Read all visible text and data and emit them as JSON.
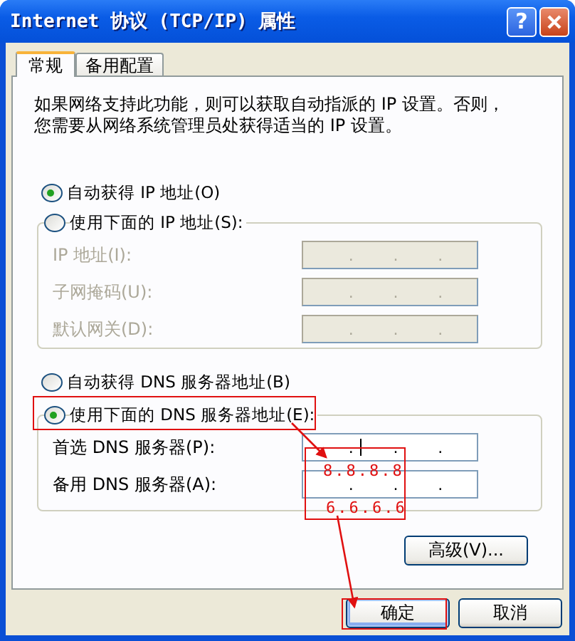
{
  "window": {
    "title": "Internet 协议 (TCP/IP) 属性",
    "help_button": "?"
  },
  "tabs": [
    {
      "label": "常规",
      "selected": true
    },
    {
      "label": "备用配置",
      "selected": false
    }
  ],
  "description": "如果网络支持此功能，则可以获取自动指派的 IP 设置。否则，您需要从网络系统管理员处获得适当的 IP 设置。",
  "ip_mode": [
    {
      "label": "自动获得 IP 地址(O)",
      "selected": true
    },
    {
      "label": "使用下面的 IP 地址(S):",
      "selected": false
    }
  ],
  "ip_fields": [
    {
      "label": "IP 地址(I):",
      "disabled": true,
      "separators": [
        ".",
        ".",
        "."
      ]
    },
    {
      "label": "子网掩码(U):",
      "disabled": true,
      "separators": [
        ".",
        ".",
        "."
      ]
    },
    {
      "label": "默认网关(D):",
      "disabled": true,
      "separators": [
        ".",
        ".",
        "."
      ]
    }
  ],
  "dns_mode": [
    {
      "label": "自动获得 DNS 服务器地址(B)",
      "selected": false
    },
    {
      "label": "使用下面的 DNS 服务器地址(E):",
      "selected": true
    }
  ],
  "dns_fields": [
    {
      "label": "首选 DNS 服务器(P):",
      "disabled": false,
      "focused": true,
      "separators": [
        ".",
        ".",
        "."
      ]
    },
    {
      "label": "备用 DNS 服务器(A):",
      "disabled": false,
      "focused": false,
      "separators": [
        ".",
        ".",
        "."
      ]
    }
  ],
  "advanced_button": "高级(V)...",
  "buttons": [
    {
      "label": "确定",
      "default": true
    },
    {
      "label": "取消",
      "default": false
    }
  ],
  "annotations": [
    {
      "kind": "box"
    },
    {
      "kind": "box"
    },
    {
      "kind": "box"
    },
    {
      "kind": "arrow"
    },
    {
      "kind": "arrow"
    },
    {
      "kind": "text",
      "text": "8.8.8.8"
    },
    {
      "kind": "text",
      "text": "6.6.6.6"
    }
  ]
}
